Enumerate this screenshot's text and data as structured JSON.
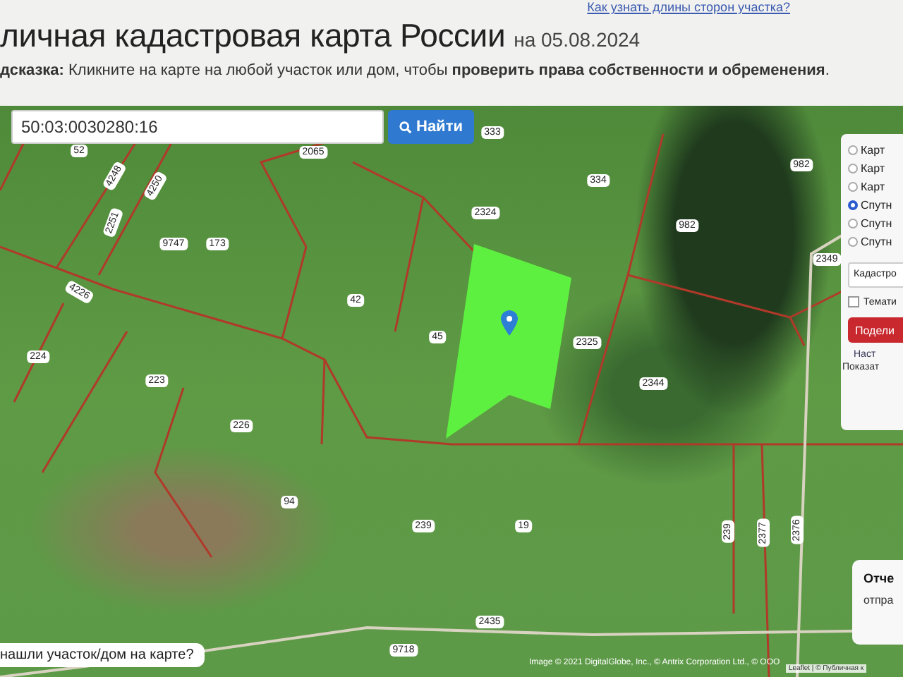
{
  "header": {
    "help_link": "Как узнать длины сторон участка?",
    "title": "личная кадастровая карта России",
    "date": "на 05.08.2024",
    "hint": "**дсказка:** Кликните на карте на любой участок или дом, чтобы **проверить права собственности и обременения**."
  },
  "search": {
    "value": "50:03:0030280:16",
    "button": "Найти"
  },
  "map": {
    "parcel_labels": [
      "52",
      "2065",
      "333",
      "334",
      "982",
      "982",
      "2324",
      "4248",
      "4250",
      "2251",
      "9747",
      "173",
      "4226",
      "42",
      "45",
      "2325",
      "2344",
      "2349",
      "224",
      "223",
      "226",
      "94",
      "239",
      "19",
      "239",
      "2377",
      "2376",
      "2435",
      "9718"
    ],
    "layer_panel": {
      "layers": [
        {
          "label": "Карт",
          "selected": false
        },
        {
          "label": "Карт",
          "selected": false
        },
        {
          "label": "Карт",
          "selected": false
        },
        {
          "label": "Спутн",
          "selected": true
        },
        {
          "label": "Спутн",
          "selected": false
        },
        {
          "label": "Спутн",
          "selected": false
        }
      ],
      "select": "Кадастро",
      "thematic": {
        "label": "Темати",
        "checked": false
      },
      "share_button": "Подели",
      "settings_link": "Наст",
      "show_link": "Показат"
    },
    "found_prompt": "нашли участок/дом на карте?",
    "attribution": "Image © 2021 DigitalGlobe, Inc., © Antrix Corporation Ltd., © ООО",
    "leaflet": "Leaflet | © Публичная к",
    "report_card": {
      "title": "Отче",
      "text": "отпра"
    }
  }
}
